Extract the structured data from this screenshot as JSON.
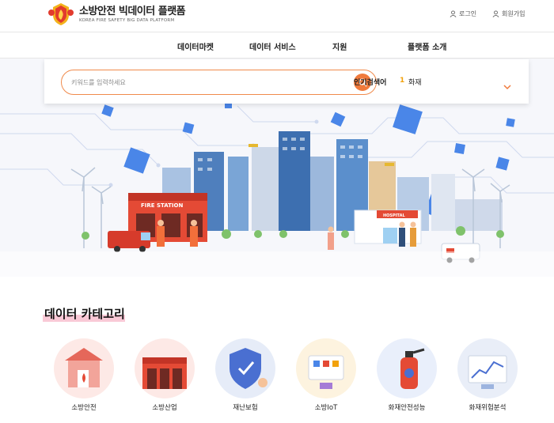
{
  "header": {
    "logo_title": "소방안전 빅데이터 플랫폼",
    "logo_subtitle": "KOREA FIRE SAFETY BIG DATA PLATFORM",
    "login_label": "로그인",
    "join_label": "회원가입"
  },
  "nav": {
    "items": [
      {
        "label": "데이터마켓"
      },
      {
        "label": "데이터 서비스"
      },
      {
        "label": "지원"
      },
      {
        "label": "플랫폼 소개"
      }
    ]
  },
  "search": {
    "placeholder": "키워드를 입력하세요",
    "value": "",
    "popular_label": "인기검색어",
    "popular_rank": "1",
    "popular_keyword": "화재"
  },
  "hero": {
    "station_sign": "FIRE STATION",
    "hospital_sign": "HOSPITAL"
  },
  "categories": {
    "title": "데이터 카테고리",
    "items": [
      {
        "label": "소방안전"
      },
      {
        "label": "소방산업"
      },
      {
        "label": "재난보험"
      },
      {
        "label": "소방IoT"
      },
      {
        "label": "화재안전성능"
      },
      {
        "label": "화재위험분석"
      }
    ]
  },
  "colors": {
    "accent": "#f07a3c",
    "highlight": "#f9c9d6",
    "rank": "#f2a20c"
  }
}
